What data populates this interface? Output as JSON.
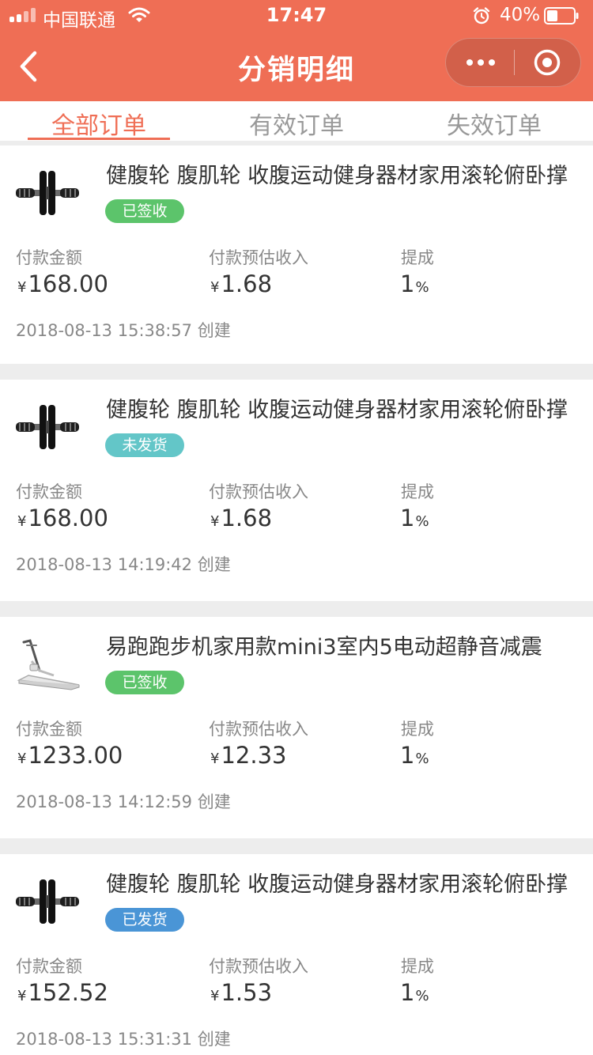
{
  "status_bar": {
    "carrier": "中国联通",
    "time": "17:47",
    "battery": "40%"
  },
  "nav": {
    "title": "分销明细"
  },
  "tabs": [
    "全部订单",
    "有效订单",
    "失效订单"
  ],
  "labels": {
    "amount": "付款金额",
    "income": "付款预估收入",
    "commission": "提成",
    "yen": "¥",
    "percent": "%",
    "created_suffix": "创建"
  },
  "orders": [
    {
      "title": "健腹轮 腹肌轮 收腹运动健身器材家用滚轮俯卧撑",
      "status": "已签收",
      "status_color": "#5cc46b",
      "thumb_icon": "ab-wheel-icon",
      "amount": "168.00",
      "income": "1.68",
      "commission": "1",
      "created": "2018-08-13 15:38:57"
    },
    {
      "title": "健腹轮 腹肌轮 收腹运动健身器材家用滚轮俯卧撑",
      "status": "未发货",
      "status_color": "#63c6c8",
      "thumb_icon": "ab-wheel-icon",
      "amount": "168.00",
      "income": "1.68",
      "commission": "1",
      "created": "2018-08-13 14:19:42"
    },
    {
      "title": "易跑跑步机家用款mini3室内5电动超静音减震",
      "status": "已签收",
      "status_color": "#5cc46b",
      "thumb_icon": "treadmill-icon",
      "amount": "1233.00",
      "income": "12.33",
      "commission": "1",
      "created": "2018-08-13 14:12:59"
    },
    {
      "title": "健腹轮 腹肌轮 收腹运动健身器材家用滚轮俯卧撑",
      "status": "已发货",
      "status_color": "#4a95d6",
      "thumb_icon": "ab-wheel-icon",
      "amount": "152.52",
      "income": "1.53",
      "commission": "1",
      "created": "2018-08-13 15:31:31"
    }
  ],
  "colors": {
    "accent": "#ef6e55",
    "background": "#ededed"
  }
}
